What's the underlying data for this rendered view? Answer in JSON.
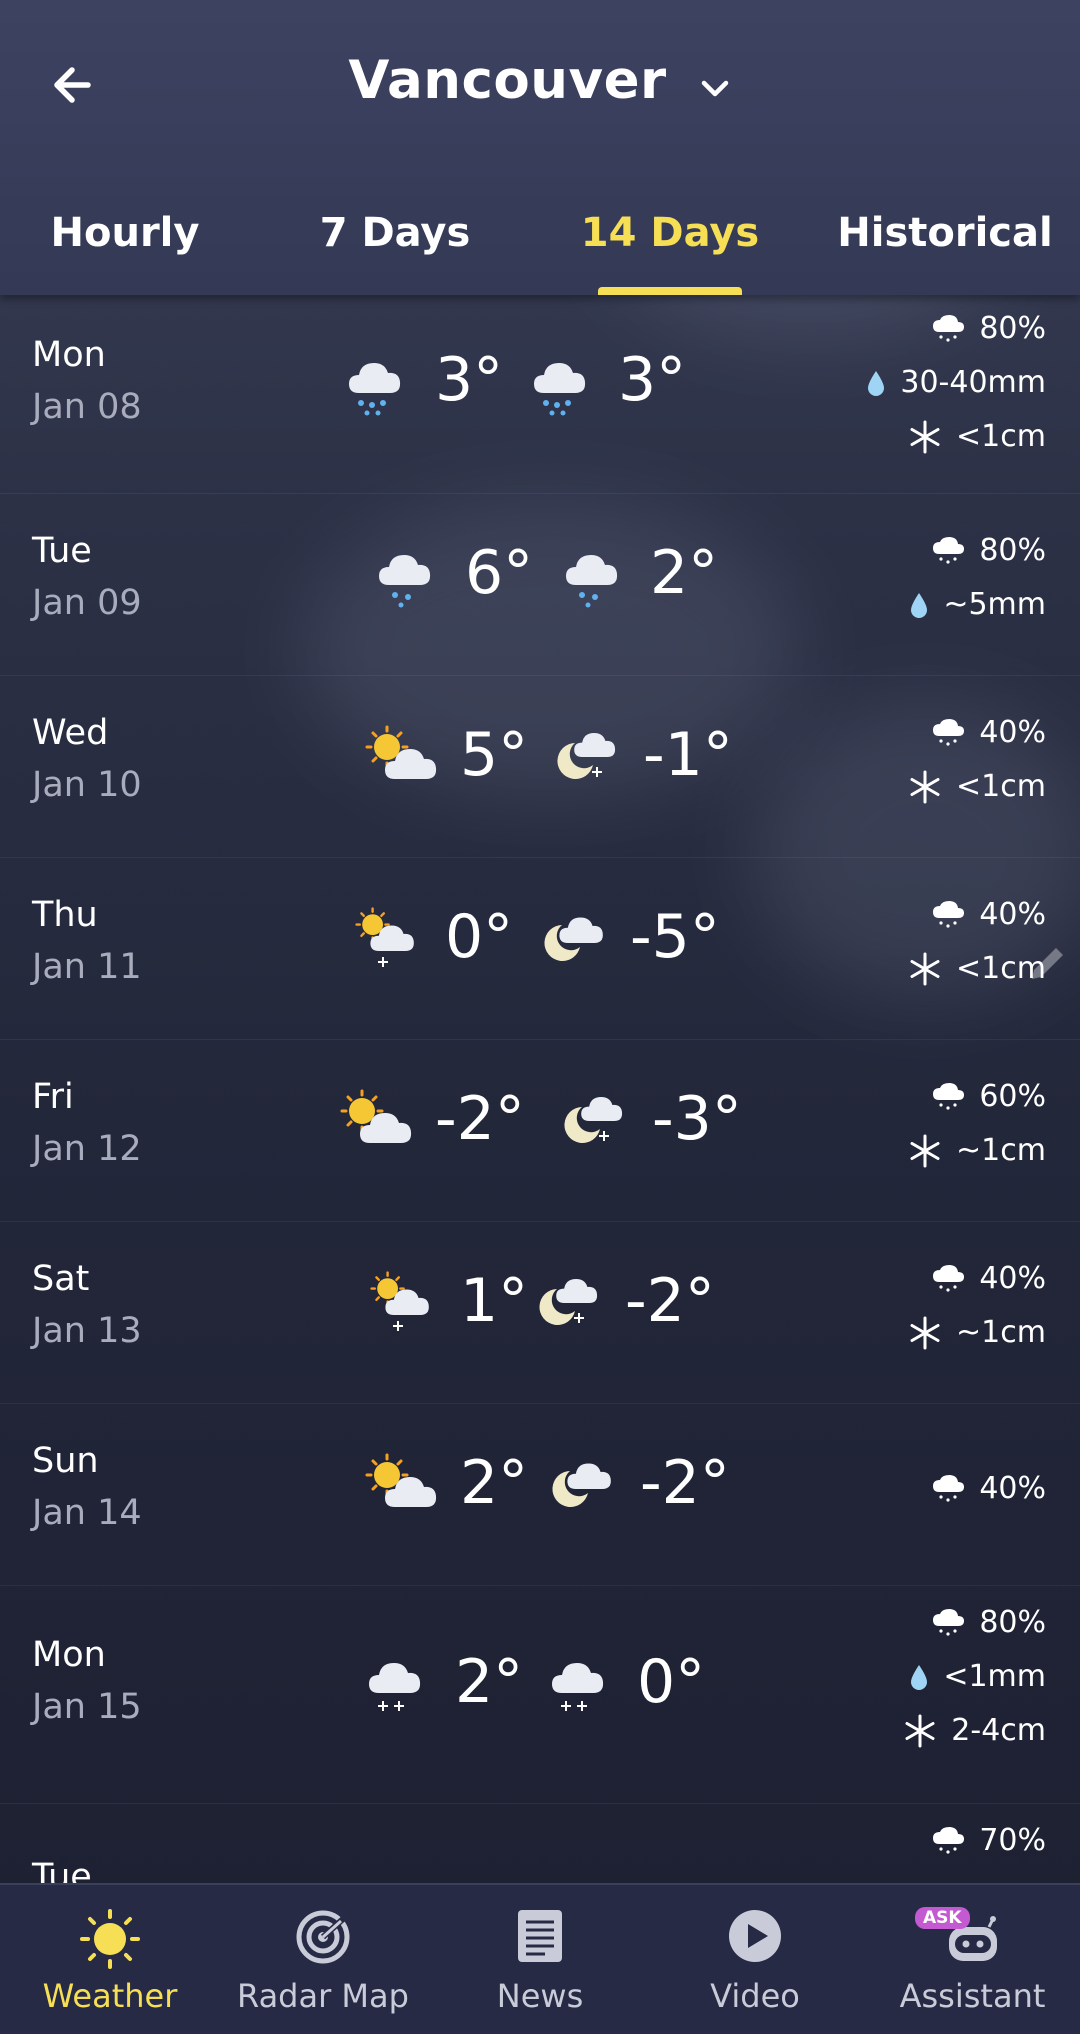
{
  "header": {
    "city": "Vancouver"
  },
  "tabs": [
    {
      "label": "Hourly",
      "active": false
    },
    {
      "label": "7 Days",
      "active": false
    },
    {
      "label": "14 Days",
      "active": true
    },
    {
      "label": "Historical",
      "active": false
    }
  ],
  "days": [
    {
      "day": "Mon",
      "date": "Jan 08",
      "day_icon": "rain-cloud-icon",
      "day_temp": "3°",
      "night_icon": "rain-cloud-icon",
      "night_temp": "3°",
      "precip_chance": "80%",
      "rain": "30-40mm",
      "snow": "<1cm"
    },
    {
      "day": "Tue",
      "date": "Jan 09",
      "day_icon": "rain-cloud-icon",
      "day_temp": "6°",
      "night_icon": "rain-cloud-icon",
      "night_temp": "2°",
      "precip_chance": "80%",
      "rain": "~5mm",
      "snow": null
    },
    {
      "day": "Wed",
      "date": "Jan 10",
      "day_icon": "partly-sunny-icon",
      "day_temp": "5°",
      "night_icon": "moon-snow-icon",
      "night_temp": "-1°",
      "precip_chance": "40%",
      "rain": null,
      "snow": "<1cm"
    },
    {
      "day": "Thu",
      "date": "Jan 11",
      "day_icon": "sun-snow-icon",
      "day_temp": "0°",
      "night_icon": "moon-cloud-icon",
      "night_temp": "-5°",
      "precip_chance": "40%",
      "rain": null,
      "snow": "<1cm"
    },
    {
      "day": "Fri",
      "date": "Jan 12",
      "day_icon": "partly-sunny-icon",
      "day_temp": "-2°",
      "night_icon": "moon-snow-icon",
      "night_temp": "-3°",
      "precip_chance": "60%",
      "rain": null,
      "snow": "~1cm"
    },
    {
      "day": "Sat",
      "date": "Jan 13",
      "day_icon": "sun-snow-icon",
      "day_temp": "1°",
      "night_icon": "moon-snow-icon",
      "night_temp": "-2°",
      "precip_chance": "40%",
      "rain": null,
      "snow": "~1cm"
    },
    {
      "day": "Sun",
      "date": "Jan 14",
      "day_icon": "partly-sunny-icon",
      "day_temp": "2°",
      "night_icon": "moon-cloud-icon",
      "night_temp": "-2°",
      "precip_chance": "40%",
      "rain": null,
      "snow": null
    },
    {
      "day": "Mon",
      "date": "Jan 15",
      "day_icon": "snow-cloud-icon",
      "day_temp": "2°",
      "night_icon": "snow-cloud-icon",
      "night_temp": "0°",
      "precip_chance": "80%",
      "rain": "<1mm",
      "snow": "2-4cm"
    },
    {
      "day": "Tue",
      "date": "",
      "day_icon": "",
      "day_temp": "",
      "night_icon": "",
      "night_temp": "",
      "precip_chance": "70%",
      "rain": null,
      "snow": null
    }
  ],
  "nav": [
    {
      "label": "Weather",
      "icon": "sun-icon",
      "active": true
    },
    {
      "label": "Radar Map",
      "icon": "radar-icon",
      "active": false
    },
    {
      "label": "News",
      "icon": "newspaper-icon",
      "active": false
    },
    {
      "label": "Video",
      "icon": "play-icon",
      "active": false
    },
    {
      "label": "Assistant",
      "icon": "robot-icon",
      "badge": "ASK",
      "active": false
    }
  ],
  "colors": {
    "accent": "#f7df55",
    "muted": "#a8acbc",
    "raindrop": "#9fd4f5"
  }
}
